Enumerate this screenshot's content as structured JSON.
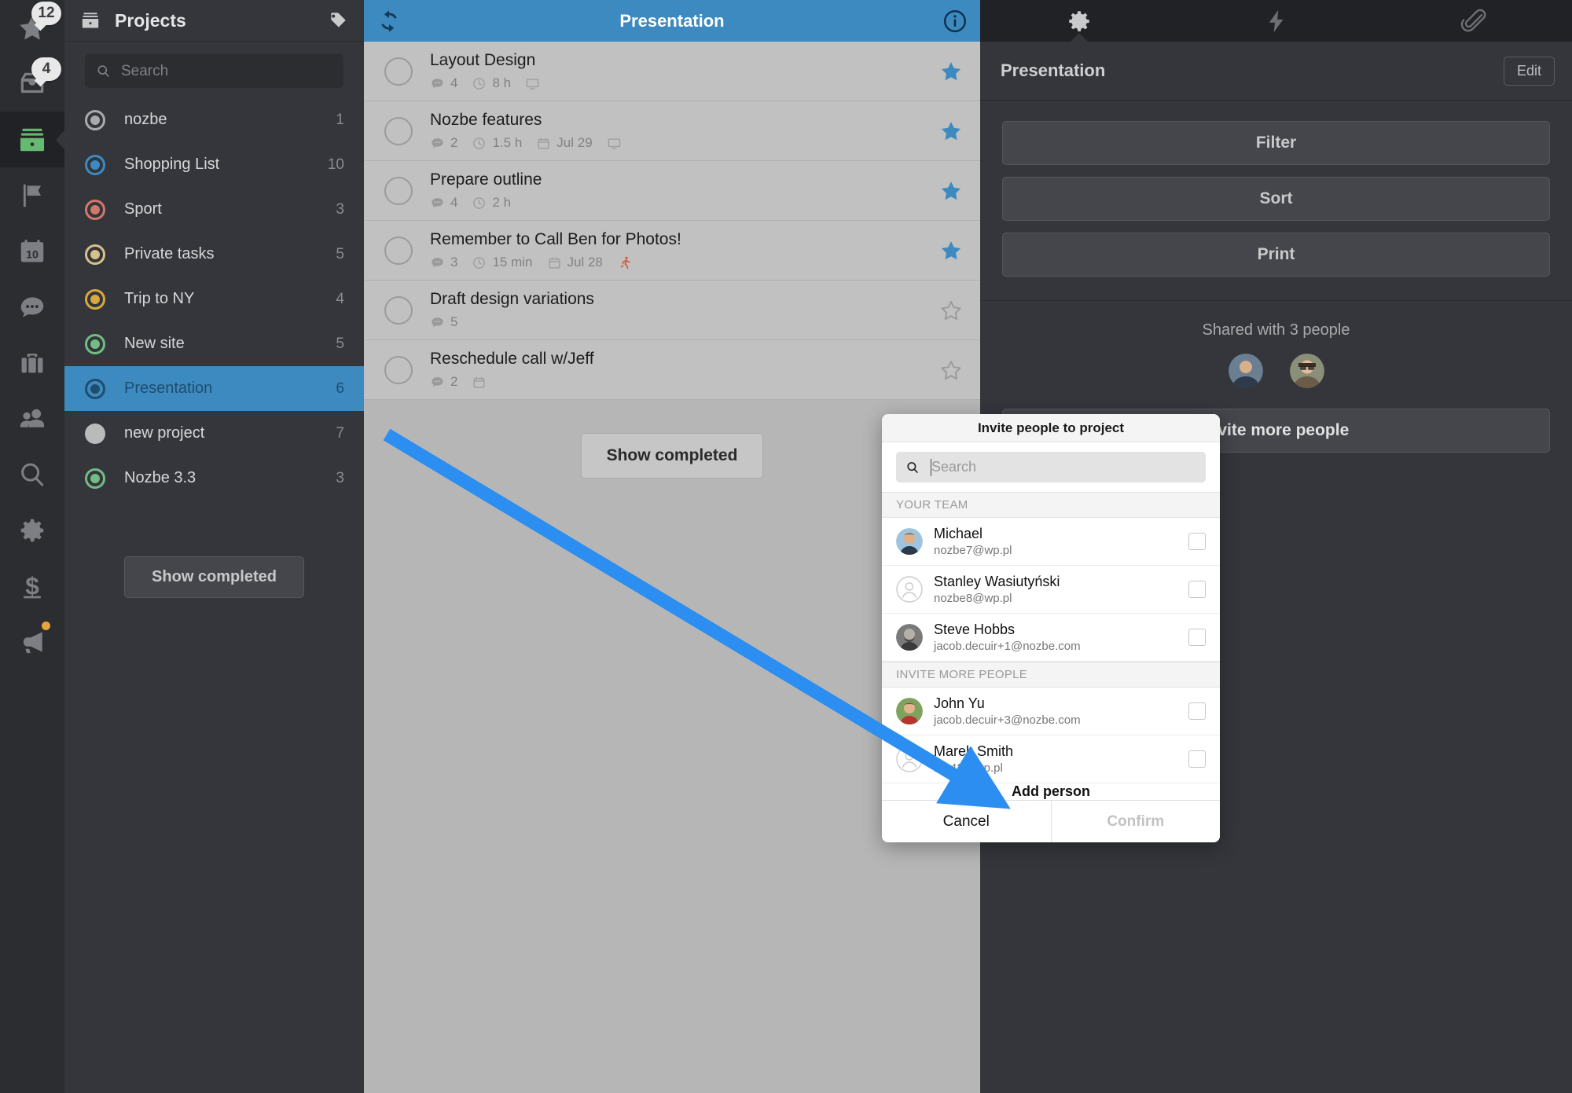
{
  "rail": {
    "items": [
      {
        "name": "priority-star-icon",
        "badge": "12"
      },
      {
        "name": "inbox-icon",
        "badge": "4"
      },
      {
        "name": "projects-wallet-icon",
        "badge": ""
      },
      {
        "name": "flag-icon",
        "badge": ""
      },
      {
        "name": "calendar-icon",
        "badge": "",
        "day": "10"
      },
      {
        "name": "comments-icon",
        "badge": ""
      },
      {
        "name": "briefcase-icon",
        "badge": ""
      },
      {
        "name": "people-icon",
        "badge": ""
      },
      {
        "name": "search-icon",
        "badge": ""
      },
      {
        "name": "settings-gear-icon",
        "badge": ""
      },
      {
        "name": "billing-dollar-icon",
        "badge": ""
      },
      {
        "name": "megaphone-icon",
        "badge": ""
      }
    ]
  },
  "sidebar": {
    "title": "Projects",
    "search_placeholder": "Search",
    "show_completed_label": "Show completed",
    "projects": [
      {
        "name": "nozbe",
        "count": "1",
        "color": "#a9aaac",
        "selected": false
      },
      {
        "name": "Shopping List",
        "count": "10",
        "color": "#3d8ac0",
        "selected": false
      },
      {
        "name": "Sport",
        "count": "3",
        "color": "#d0796a",
        "selected": false
      },
      {
        "name": "Private tasks",
        "count": "5",
        "color": "#d9c08a",
        "selected": false
      },
      {
        "name": "Trip to NY",
        "count": "4",
        "color": "#d8a93f",
        "selected": false
      },
      {
        "name": "New site",
        "count": "5",
        "color": "#72bd84",
        "selected": false
      },
      {
        "name": "Presentation",
        "count": "6",
        "color": "#1f4d6e",
        "selected": true
      },
      {
        "name": "new project",
        "count": "7",
        "color": "#b9babc",
        "selected": false
      },
      {
        "name": "Nozbe 3.3",
        "count": "3",
        "color": "#72bd84",
        "selected": false
      }
    ]
  },
  "tasklist": {
    "title": "Presentation",
    "sync_icon": "sync-icon",
    "info_icon": "info-icon",
    "show_completed_label": "Show completed",
    "tasks": [
      {
        "name": "Layout Design",
        "comments": "4",
        "time": "8 h",
        "date": "",
        "starred": true,
        "has_computer": true,
        "has_runner": false
      },
      {
        "name": "Nozbe features",
        "comments": "2",
        "time": "1.5 h",
        "date": "Jul 29",
        "starred": true,
        "has_computer": true,
        "has_runner": false
      },
      {
        "name": "Prepare outline",
        "comments": "4",
        "time": "2 h",
        "date": "",
        "starred": true,
        "has_computer": false,
        "has_runner": false
      },
      {
        "name": "Remember to Call Ben for Photos!",
        "comments": "3",
        "time": "15 min",
        "date": "Jul 28",
        "starred": true,
        "has_computer": false,
        "has_runner": true
      },
      {
        "name": "Draft design variations",
        "comments": "5",
        "time": "",
        "date": "",
        "starred": false,
        "has_computer": false,
        "has_runner": false
      },
      {
        "name": "Reschedule call w/Jeff",
        "comments": "2",
        "time": "",
        "date": " ",
        "starred": false,
        "has_computer": false,
        "has_runner": false
      }
    ]
  },
  "rightpane": {
    "tabs": [
      {
        "name": "settings-gear-icon",
        "active": true
      },
      {
        "name": "lightning-bolt-icon",
        "active": false
      },
      {
        "name": "paperclip-icon",
        "active": false
      }
    ],
    "project_name": "Presentation",
    "edit_label": "Edit",
    "filter_label": "Filter",
    "sort_label": "Sort",
    "print_label": "Print",
    "shared_label": "Shared with 3 people",
    "invite_label": "Invite more people"
  },
  "modal": {
    "title": "Invite people to project",
    "search_placeholder": "Search",
    "group_team": "YOUR TEAM",
    "group_invite": "INVITE MORE PEOPLE",
    "team": [
      {
        "name": "Michael",
        "email": "nozbe7@wp.pl",
        "photo": true
      },
      {
        "name": "Stanley Wasiutyński",
        "email": "nozbe8@wp.pl",
        "photo": false
      },
      {
        "name": "Steve Hobbs",
        "email": "jacob.decuir+1@nozbe.com",
        "photo": true
      }
    ],
    "more": [
      {
        "name": "John Yu",
        "email": "jacob.decuir+3@nozbe.com",
        "photo": true
      },
      {
        "name": "Marek Smith",
        "email": "no    42@wp.pl",
        "photo": false
      }
    ],
    "add_person_label": "Add person",
    "cancel_label": "Cancel",
    "confirm_label": "Confirm"
  },
  "colors": {
    "accent_blue": "#3d8ac0",
    "arrow_blue": "#2b8ef0",
    "dark_panel": "#34363b",
    "rail_dark": "#2b2d31"
  }
}
